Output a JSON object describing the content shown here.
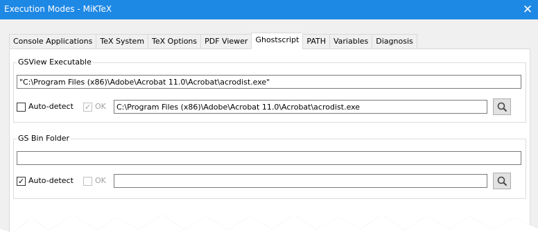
{
  "window": {
    "title": "Execution Modes - MiKTeX",
    "close_glyph": "✕",
    "titlebar_color": "#1e88e5"
  },
  "tabs": [
    {
      "label": "Console Applications",
      "active": false
    },
    {
      "label": "TeX System",
      "active": false
    },
    {
      "label": "TeX Options",
      "active": false
    },
    {
      "label": "PDF Viewer",
      "active": false
    },
    {
      "label": "Ghostscript",
      "active": true
    },
    {
      "label": "PATH",
      "active": false
    },
    {
      "label": "Variables",
      "active": false
    },
    {
      "label": "Diagnosis",
      "active": false
    }
  ],
  "gsview": {
    "group_label": "GSView Executable",
    "path_value": "\"C:\\Program Files (x86)\\Adobe\\Acrobat 11.0\\Acrobat\\acrodist.exe\"",
    "autodetect_label": "Auto-detect",
    "autodetect_checked": false,
    "ok_label": "OK",
    "ok_checked": true,
    "resolved_value": "C:\\Program Files (x86)\\Adobe\\Acrobat 11.0\\Acrobat\\acrodist.exe",
    "browse_icon": "search-icon"
  },
  "gsbin": {
    "group_label": "GS Bin Folder",
    "path_value": "",
    "autodetect_label": "Auto-detect",
    "autodetect_checked": true,
    "ok_label": "OK",
    "ok_checked": false,
    "resolved_value": "",
    "browse_icon": "search-icon"
  }
}
